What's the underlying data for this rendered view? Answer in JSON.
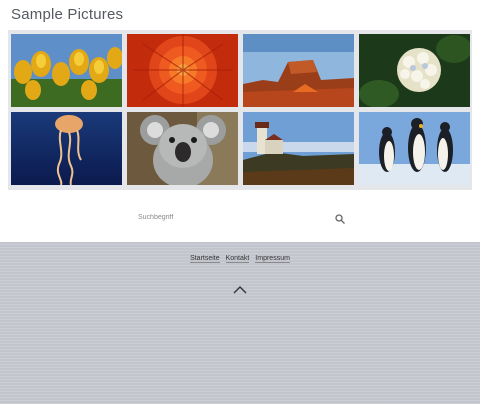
{
  "gallery": {
    "title": "Sample Pictures",
    "images": [
      {
        "subject": "tulips"
      },
      {
        "subject": "chrysanthemum"
      },
      {
        "subject": "desert"
      },
      {
        "subject": "hydrangeas"
      },
      {
        "subject": "jellyfish"
      },
      {
        "subject": "koala"
      },
      {
        "subject": "lighthouse"
      },
      {
        "subject": "penguins"
      }
    ]
  },
  "search": {
    "placeholder": "Suchbegriff"
  },
  "footer": {
    "links": [
      "Startseite",
      "Kontakt",
      "Impressum"
    ]
  },
  "colors": {
    "page_background": "#c9cbd4",
    "panel_background": "#ffffff",
    "gallery_frame": "#e4e6ea"
  },
  "icons": {
    "search": "magnifier-icon",
    "scroll_top": "chevron-up-icon"
  }
}
